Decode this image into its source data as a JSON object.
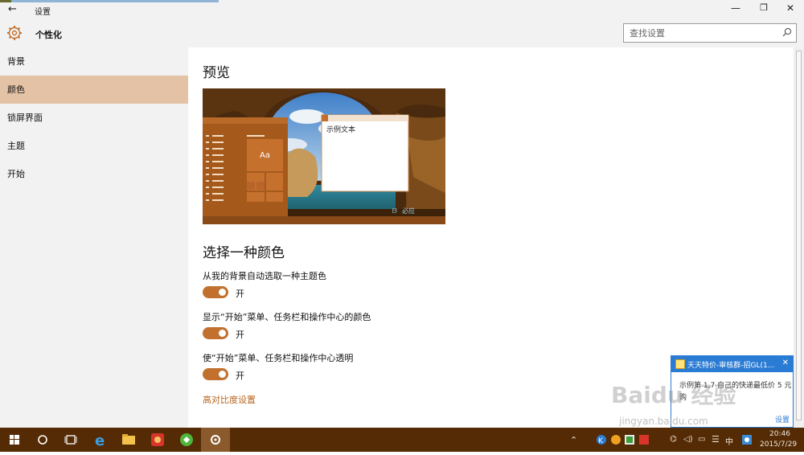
{
  "window": {
    "title": "设置",
    "back_icon": "back-arrow-icon",
    "minimize_glyph": "—",
    "maximize_glyph": "❐",
    "close_glyph": "✕"
  },
  "header": {
    "title": "个性化",
    "icon": "gear-icon",
    "search_placeholder": "查找设置"
  },
  "sidebar": {
    "items": [
      {
        "label": "背景",
        "active": false
      },
      {
        "label": "颜色",
        "active": true
      },
      {
        "label": "锁屏界面",
        "active": false
      },
      {
        "label": "主题",
        "active": false
      },
      {
        "label": "开始",
        "active": false
      }
    ]
  },
  "main": {
    "preview_title": "预览",
    "preview_window_text": "示例文本",
    "preview_tile_text": "Aa",
    "preview_watermark": "必应",
    "color_title": "选择一种颜色",
    "options": [
      {
        "label": "从我的背景自动选取一种主题色",
        "state": "开",
        "on": true
      },
      {
        "label": "显示“开始”菜单、任务栏和操作中心的颜色",
        "state": "开",
        "on": true
      },
      {
        "label": "使“开始”菜单、任务栏和操作中心透明",
        "state": "开",
        "on": true
      }
    ],
    "high_contrast_link": "高对比度设置"
  },
  "notification": {
    "title": "天天特价-审核群-招GL(1...",
    "body": "示例第 1,7 自己的快递最低价 5 元购",
    "settings": "设置",
    "close_glyph": "✕"
  },
  "taskbar": {
    "ime": "中",
    "time": "20:46",
    "date": "2015/7/29"
  },
  "watermark": {
    "brand": "Baidu 经验",
    "url": "jingyan.baidu.com"
  },
  "colors": {
    "accent": "#c1702e",
    "selected_nav": "#e4c2a6",
    "taskbar": "#542b05",
    "link": "#b8651f"
  }
}
